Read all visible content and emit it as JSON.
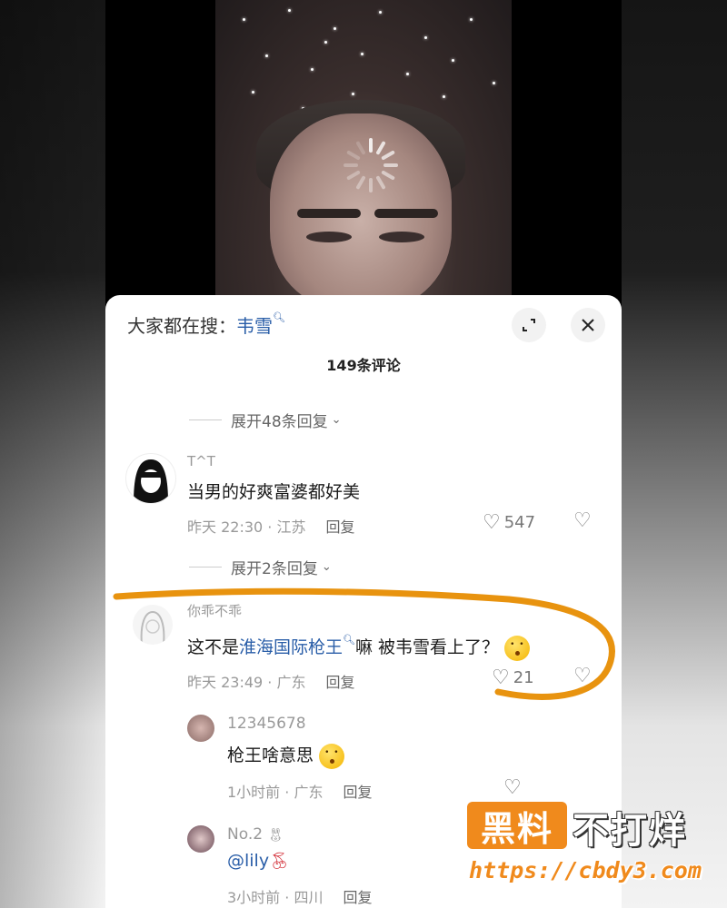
{
  "search": {
    "prefix": "大家都在搜：",
    "keyword": "韦雪"
  },
  "header": {
    "comment_count": "149条评论"
  },
  "threads": {
    "expand_top": "展开48条回复",
    "expand_mid": "展开2条回复"
  },
  "comments": [
    {
      "username": "T^T",
      "text": "当男的好爽富婆都好美",
      "time": "昨天 22:30 · 江苏",
      "reply": "回复",
      "likes": "547"
    },
    {
      "username": "你乖不乖",
      "text_before": "这不是",
      "link": "淮海国际枪王",
      "text_after": "嘛 被韦雪看上了？",
      "time": "昨天 23:49 · 广东",
      "reply": "回复",
      "likes": "21"
    }
  ],
  "replies": [
    {
      "username": "12345678",
      "text": "枪王啥意思",
      "time": "1小时前 · 广东",
      "reply": "回复"
    },
    {
      "username": "No.2",
      "text": "@lily",
      "time": "3小时前 · 四川",
      "reply": "回复"
    }
  ],
  "watermark": {
    "brand": "黑料",
    "slogan": "不打烊",
    "url": "https://cbdy3.com"
  },
  "colors": {
    "link": "#2a5ea8",
    "highlight": "#e8930f",
    "brand": "#f08a1c"
  }
}
